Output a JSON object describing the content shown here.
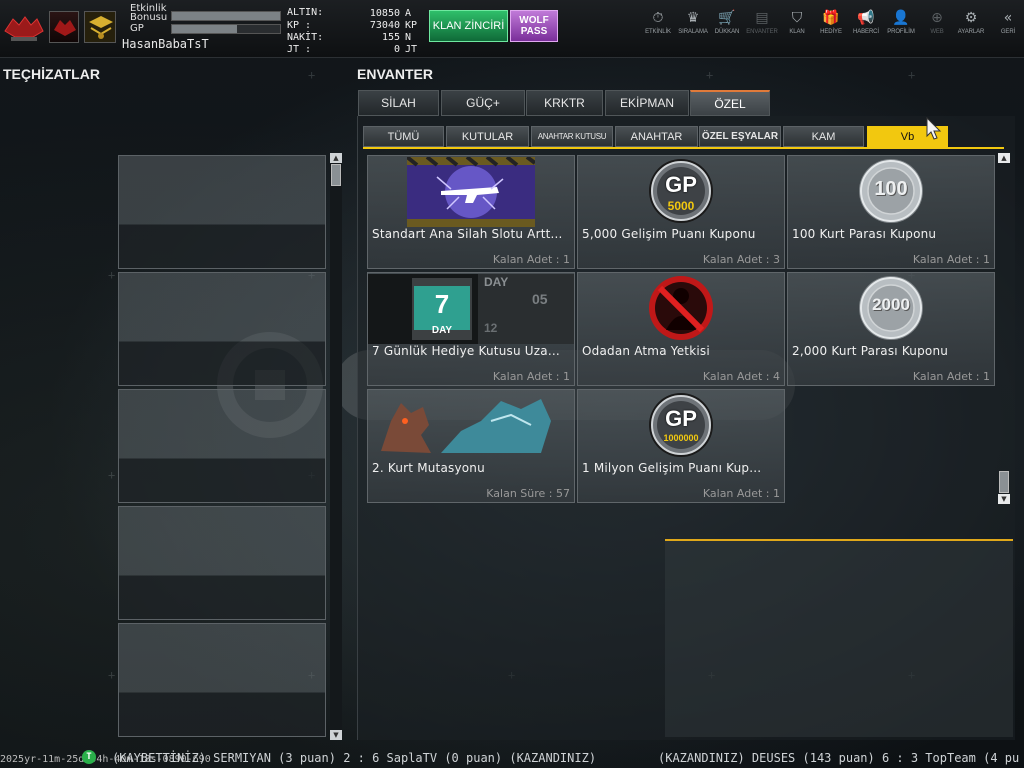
{
  "player": {
    "event_bonus_label_1": "Etkinlik",
    "event_bonus_label_2": "Bonusu",
    "event_bonus_fraction": 1.0,
    "gp_label": "GP",
    "gp_fraction": 0.6,
    "username": "HasanBabaTsT"
  },
  "currencies": [
    {
      "label": "ALTIN:",
      "value": "10850",
      "unit": "A"
    },
    {
      "label": "KP  :",
      "value": "73040",
      "unit": "KP"
    },
    {
      "label": "NAKİT:",
      "value": "155",
      "unit": "N"
    },
    {
      "label": "JT  :",
      "value": "0",
      "unit": "JT"
    }
  ],
  "klan_button": "KLAN ZİNCİRİ",
  "wolfpass": {
    "line1": "WOLF",
    "line2": "PASS"
  },
  "nav": [
    {
      "label": "ETKİNLİK",
      "icon": "stopwatch-icon",
      "glyph": "⏱",
      "dim": false
    },
    {
      "label": "SIRALAMA",
      "icon": "medal-icon",
      "glyph": "♛",
      "dim": false
    },
    {
      "label": "DÜKKAN",
      "icon": "cart-icon",
      "glyph": "🛒",
      "dim": false
    },
    {
      "label": "ENVANTER",
      "icon": "inventory-icon",
      "glyph": "▤",
      "dim": true
    },
    {
      "label": "KLAN",
      "icon": "shield-icon",
      "glyph": "⛉",
      "dim": false
    },
    {
      "label": "HEDİYE",
      "icon": "gift-icon",
      "glyph": "🎁",
      "dim": false
    },
    {
      "label": "HABERCİ",
      "icon": "megaphone-icon",
      "glyph": "📢",
      "dim": false
    },
    {
      "label": "PROFİLİM",
      "icon": "profile-icon",
      "glyph": "👤",
      "dim": false
    },
    {
      "label": "WEB",
      "icon": "globe-icon",
      "glyph": "⊕",
      "dim": true
    },
    {
      "label": "AYARLAR",
      "icon": "gear-icon",
      "glyph": "⚙",
      "dim": false
    },
    {
      "label": "GERİ",
      "icon": "back-chevron-icon",
      "glyph": "«",
      "dim": false
    }
  ],
  "equipment_title": "TEÇHİZATLAR",
  "inventory_title": "ENVANTER",
  "tabs": [
    "SİLAH",
    "GÜÇ+",
    "KRKTR",
    "EKİPMAN",
    "ÖZEL"
  ],
  "active_tab": "ÖZEL",
  "subtabs": [
    "TÜMÜ",
    "KUTULAR",
    "ANAHTAR KUTUSU",
    "ANAHTAR",
    "ÖZEL EŞYALAR",
    "KAM",
    "Vb"
  ],
  "active_subtab": "Vb",
  "items": [
    {
      "name": "Standart Ana Silah Slotu Artt...",
      "qty": "Kalan Adet : 1",
      "image": "weapon-slot-image"
    },
    {
      "name": "5,000 Gelişim Puanı Kuponu",
      "qty": "Kalan Adet : 3",
      "image": "gp-coin-image",
      "badge": "GP",
      "sub": "5000"
    },
    {
      "name": "100 Kurt Parası Kuponu",
      "qty": "Kalan Adet : 1",
      "image": "silver-coin-image",
      "badge": "100"
    },
    {
      "name": "7 Günlük Hediye Kutusu Uza...",
      "qty": "Kalan Adet : 1",
      "image": "day-box-image",
      "day_num": "7",
      "day_label": "DAY",
      "day_num2": "05",
      "day_num3": "12"
    },
    {
      "name": "Odadan Atma Yetkisi",
      "qty": "Kalan Adet : 4",
      "image": "kick-permission-image"
    },
    {
      "name": "2,000  Kurt Parası Kuponu",
      "qty": "Kalan Adet : 1",
      "image": "silver-coin-image",
      "badge": "2000"
    },
    {
      "name": "2. Kurt Mutasyonu",
      "qty": "Kalan Süre : 57",
      "image": "werewolf-image"
    },
    {
      "name": "1 Milyon Gelişim Puanı Kup...",
      "qty": "Kalan Adet : 1",
      "image": "gp-coin-image",
      "badge": "GP",
      "sub": "1000000"
    }
  ],
  "ticker": {
    "timestamp": "2025yr-11m-25d-04h-40m-18s-0890-690",
    "icon_letter": "T",
    "message1": "(KAYBETTİNİZ) SERMIYAN (3 puan) 2 : 6 SaplaTV (0 puan) (KAZANDINIZ)",
    "message2": "(KAZANDINIZ) DEUSES (143 puan) 6 : 3 TopTeam (4 pu"
  },
  "colors": {
    "accent_yellow": "#f2c80f",
    "tab_accent": "#e07a3a",
    "klan_green": "#2fbf6a",
    "wolfpass_purple": "#a455c6"
  }
}
